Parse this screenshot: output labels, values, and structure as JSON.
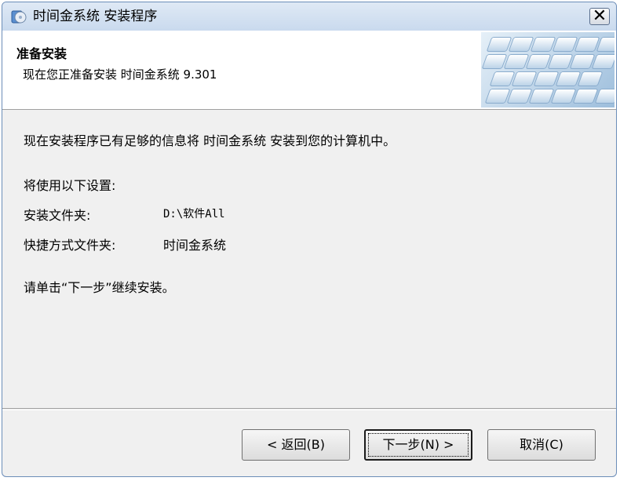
{
  "window": {
    "title": "时间金系统 安装程序",
    "close_glyph": "✕"
  },
  "header": {
    "title": "准备安装",
    "subtitle": "现在您正准备安装 时间金系统 9.301"
  },
  "content": {
    "intro": "现在安装程序已有足够的信息将 时间金系统 安装到您的计算机中。",
    "settings_heading": "将使用以下设置:",
    "install_folder_label": "安装文件夹:",
    "install_folder_value": "D:\\软件All",
    "shortcut_folder_label": "快捷方式文件夹:",
    "shortcut_folder_value": "时间金系统",
    "instruction": "请单击“下一步”继续安装。"
  },
  "buttons": {
    "back": "< 返回(B)",
    "next": "下一步(N) >",
    "cancel": "取消(C)"
  },
  "icons": {
    "app": "installer-cd-icon",
    "close": "close-icon"
  }
}
